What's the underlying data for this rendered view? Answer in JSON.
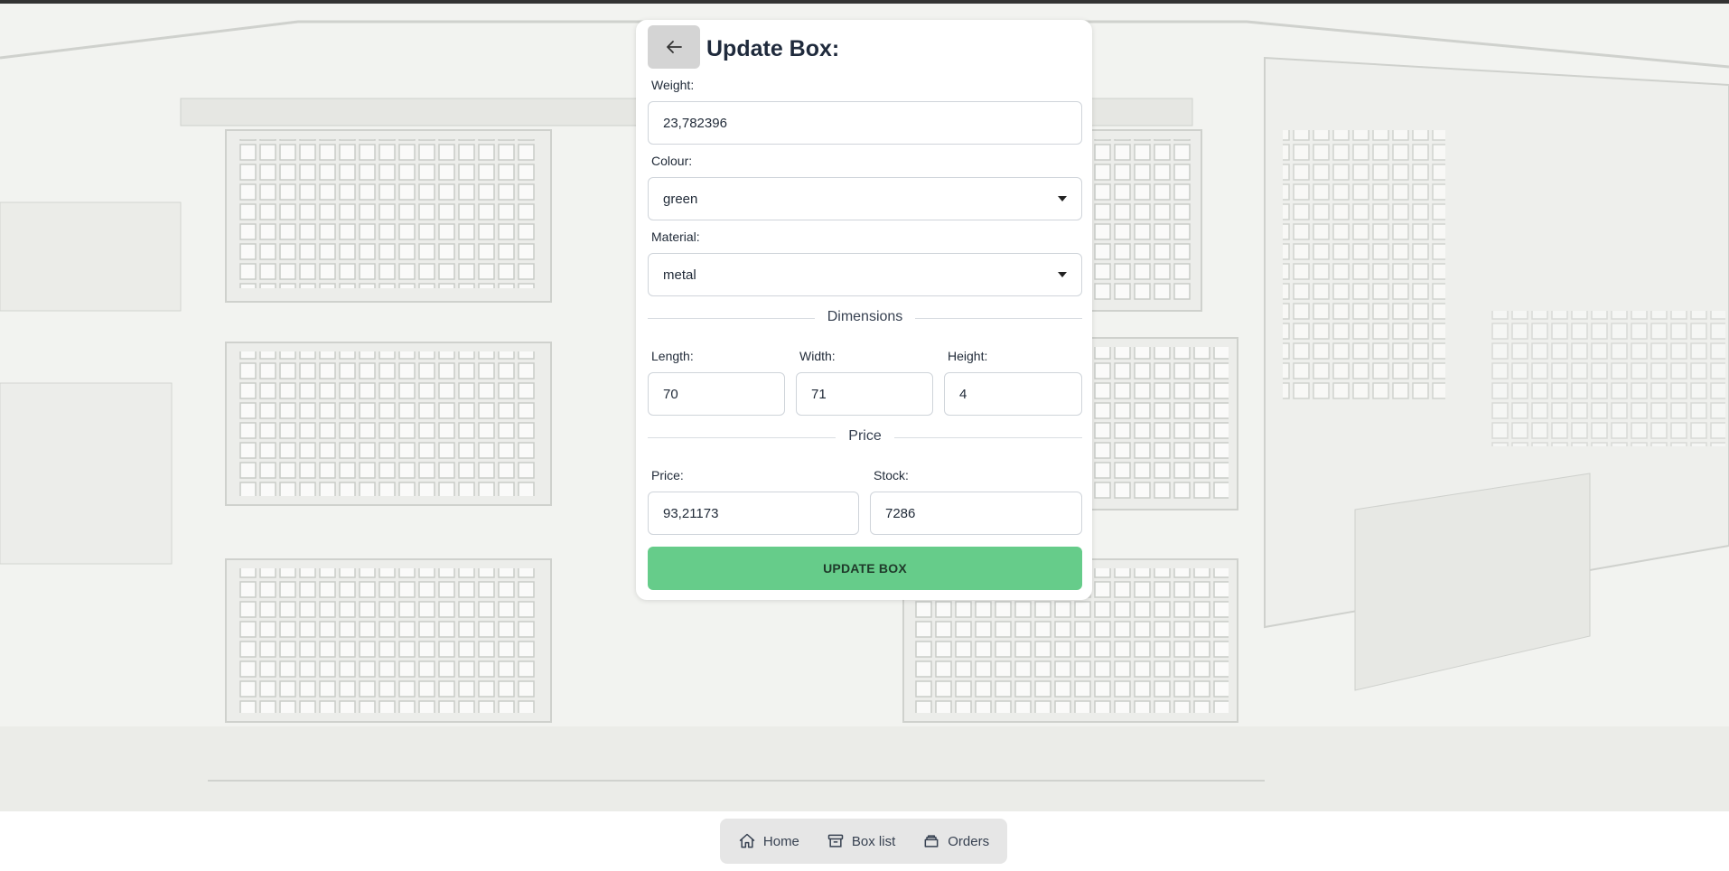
{
  "form": {
    "title": "Update Box:",
    "weight": {
      "label": "Weight:",
      "value": "23,782396"
    },
    "colour": {
      "label": "Colour:",
      "value": "green"
    },
    "material": {
      "label": "Material:",
      "value": "metal"
    },
    "dimensions_heading": "Dimensions",
    "length": {
      "label": "Length:",
      "value": "70"
    },
    "width": {
      "label": "Width:",
      "value": "71"
    },
    "height": {
      "label": "Height:",
      "value": "4"
    },
    "price_heading": "Price",
    "price": {
      "label": "Price:",
      "value": "93,21173"
    },
    "stock": {
      "label": "Stock:",
      "value": "7286"
    },
    "submit_label": "UPDATE BOX"
  },
  "nav": {
    "items": [
      {
        "label": "Home",
        "icon": "home-icon"
      },
      {
        "label": "Box list",
        "icon": "archive-box-icon"
      },
      {
        "label": "Orders",
        "icon": "orders-icon"
      }
    ]
  },
  "colors": {
    "accent": "#66cc8a",
    "back_button": "#d4d4d4",
    "nav_background": "#e6e6e6"
  }
}
